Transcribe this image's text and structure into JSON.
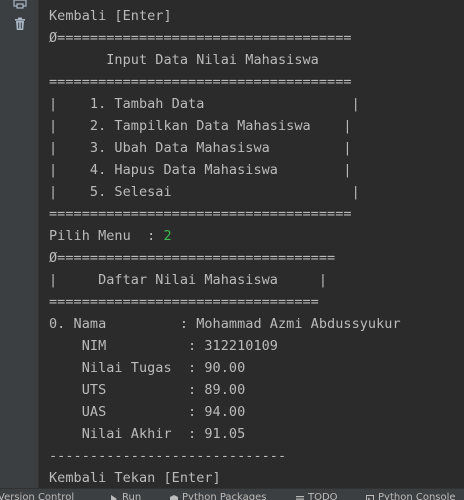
{
  "console": {
    "lines": [
      {
        "text": "Kembali [Enter]"
      },
      {
        "text": "Ø===================================="
      },
      {
        "text": "       Input Data Nilai Mahasiswa"
      },
      {
        "text": "====================================="
      },
      {
        "text": "|    1. Tambah Data                  |"
      },
      {
        "text": "|    2. Tampilkan Data Mahasiswa    |"
      },
      {
        "text": "|    3. Ubah Data Mahasiswa         |"
      },
      {
        "text": "|    4. Hapus Data Mahasiswa        |"
      },
      {
        "text": "|    5. Selesai                      |"
      },
      {
        "text": "====================================="
      },
      {
        "text": "Pilih Menu  : ",
        "input": "2"
      },
      {
        "text": "Ø=================================="
      },
      {
        "text": "|     Daftar Nilai Mahasiswa     |"
      },
      {
        "text": "================================="
      },
      {
        "text": "0. Nama         : Mohammad Azmi Abdussyukur"
      },
      {
        "text": "    NIM          : 312210109"
      },
      {
        "text": "    Nilai Tugas  : 90.00"
      },
      {
        "text": "    UTS          : 89.00"
      },
      {
        "text": "    UAS          : 94.00"
      },
      {
        "text": "    Nilai Akhir  : 91.05"
      },
      {
        "text": "-----------------------------"
      },
      {
        "text": "Kembali Tekan [Enter]"
      }
    ],
    "input_color": "#3fb950"
  },
  "gutter": {
    "icons": [
      "print-icon",
      "trash-icon"
    ]
  },
  "tool_windows": [
    {
      "label": "Version Control",
      "icon": "version-control-icon"
    },
    {
      "label": "Run",
      "icon": "run-icon"
    },
    {
      "label": "Python Packages",
      "icon": "packages-icon"
    },
    {
      "label": "TODO",
      "icon": "todo-icon"
    },
    {
      "label": "Python Console",
      "icon": "python-console-icon"
    }
  ]
}
